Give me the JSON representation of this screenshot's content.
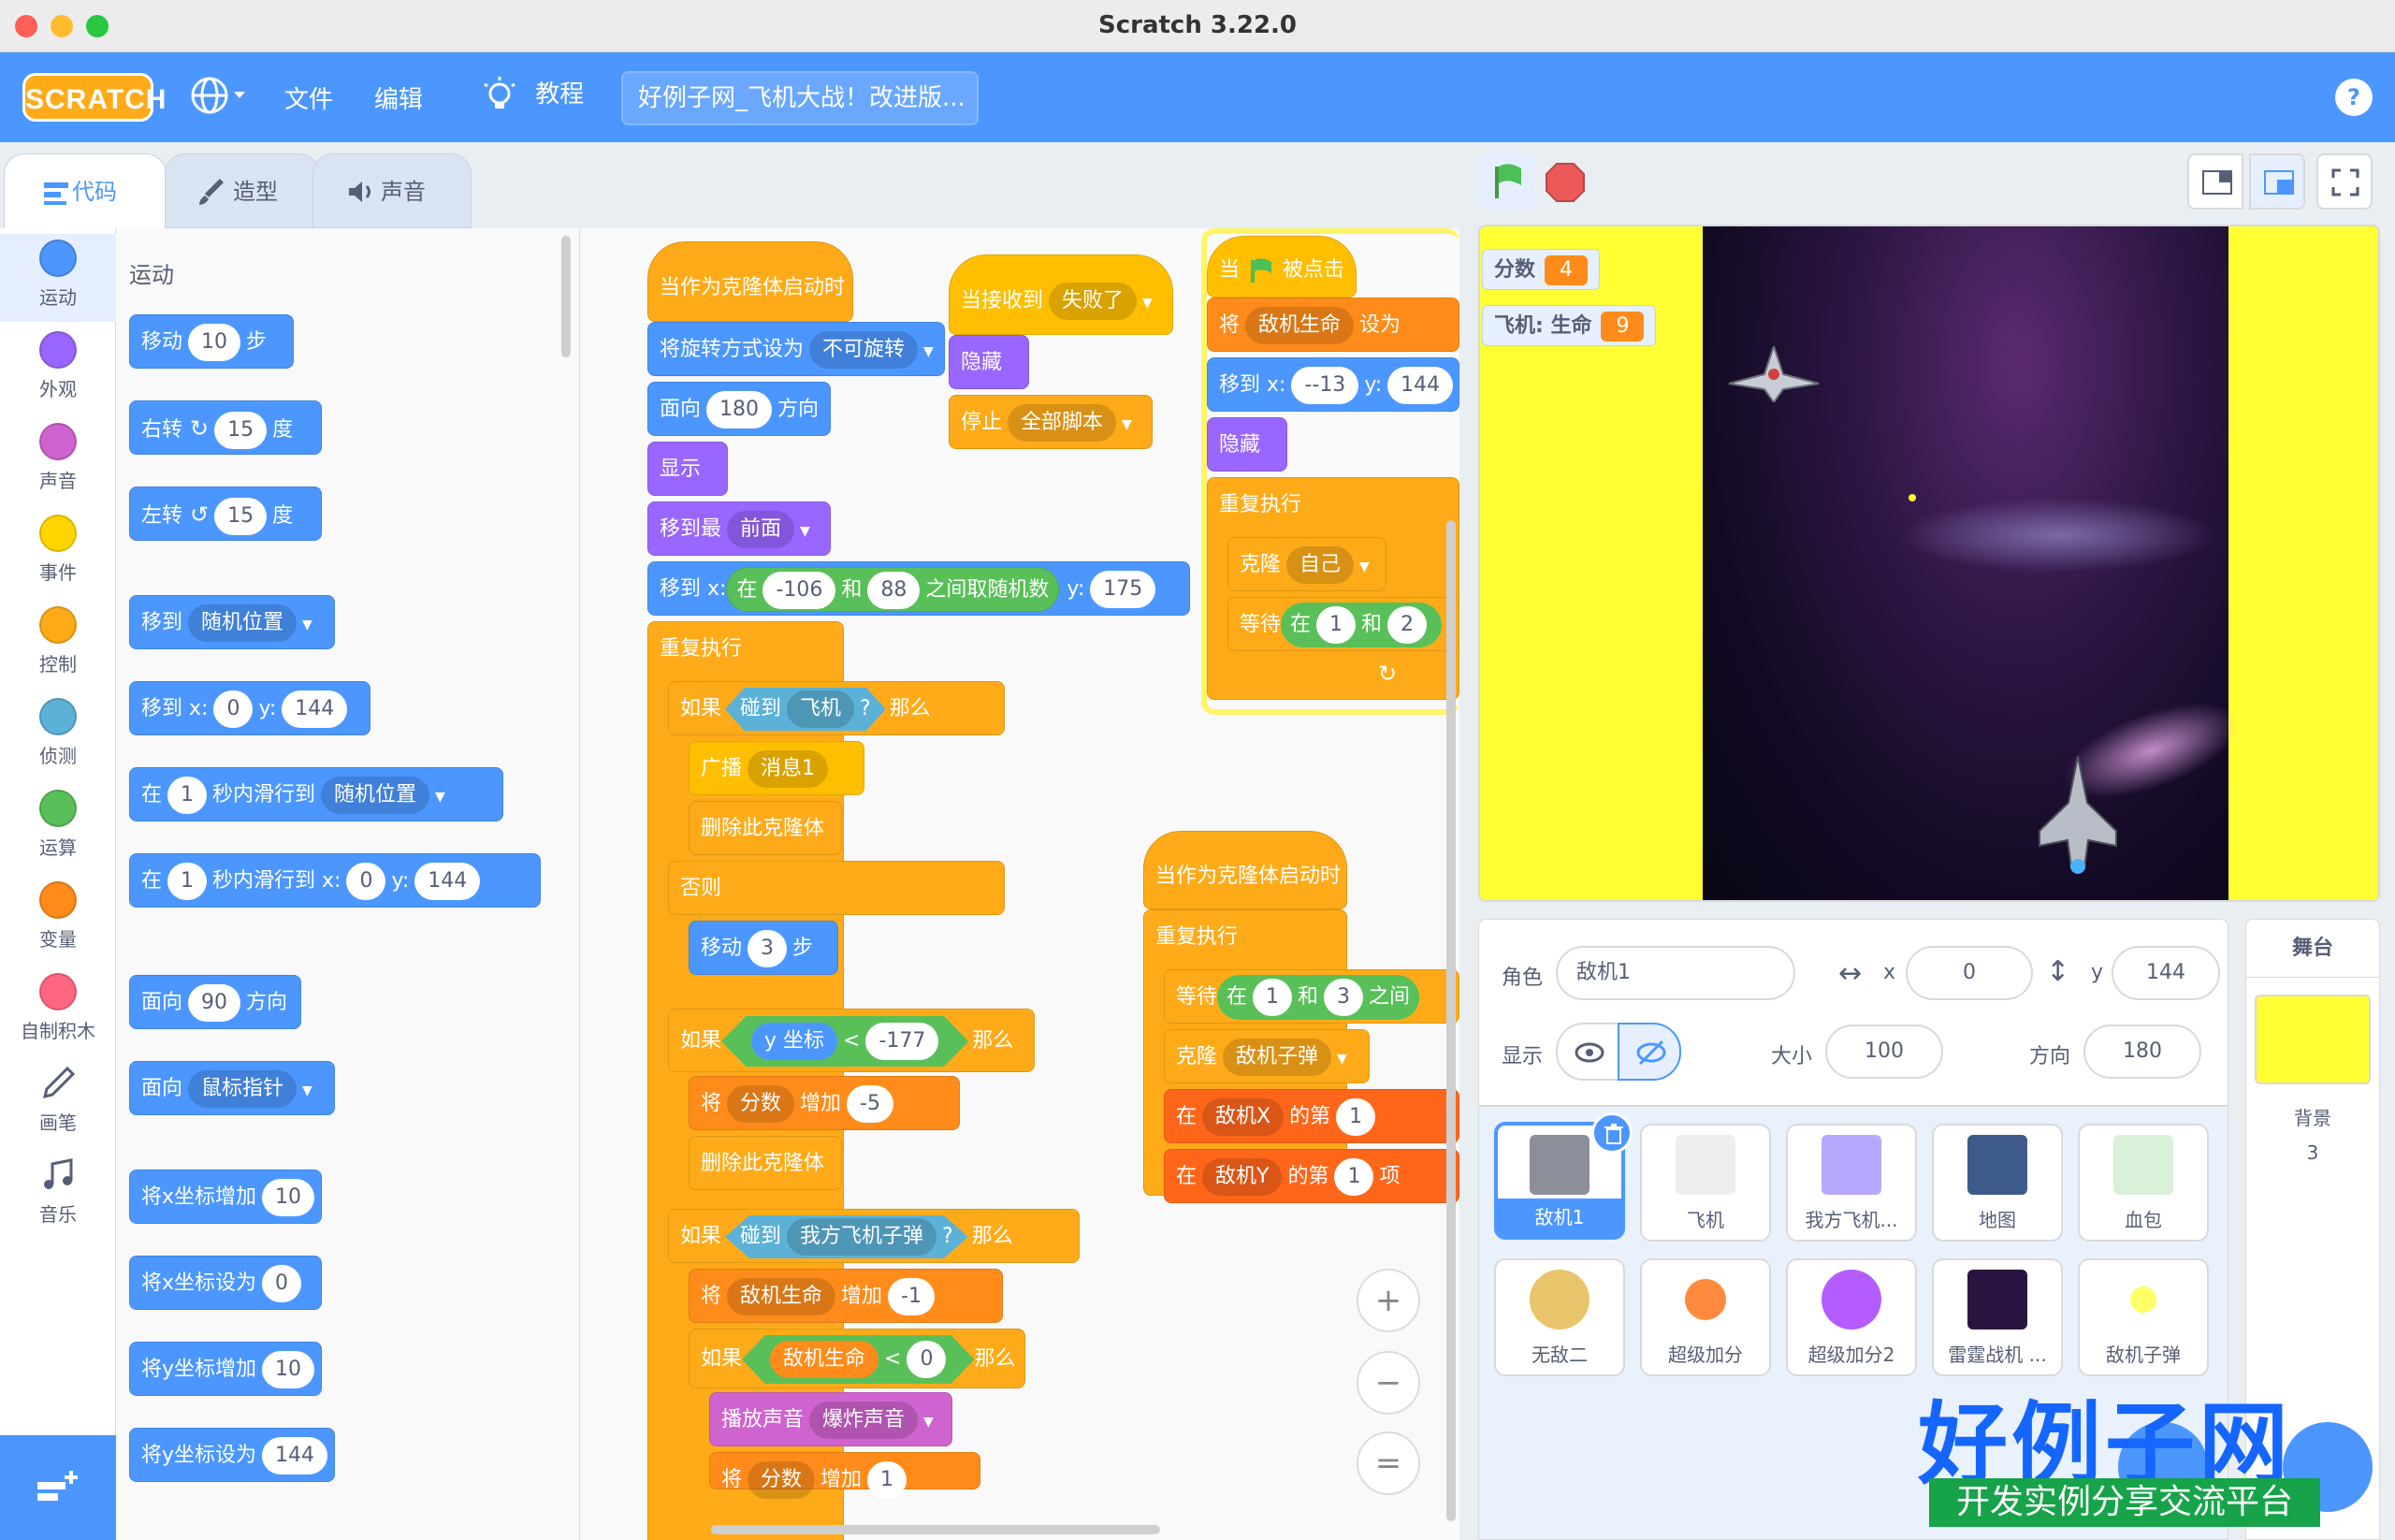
{
  "window": {
    "title": "Scratch 3.22.0"
  },
  "menubar": {
    "logo": "SCRATCH",
    "file": "文件",
    "edit": "编辑",
    "tutorials": "教程",
    "project_title": "好例子网_飞机大战！改进版...",
    "help": "?"
  },
  "tabs": [
    {
      "label": "代码"
    },
    {
      "label": "造型"
    },
    {
      "label": "声音"
    }
  ],
  "categories": [
    {
      "label": "运动",
      "color": "#4c97ff"
    },
    {
      "label": "外观",
      "color": "#9966ff"
    },
    {
      "label": "声音",
      "color": "#cf63cf"
    },
    {
      "label": "事件",
      "color": "#ffd500"
    },
    {
      "label": "控制",
      "color": "#ffab19"
    },
    {
      "label": "侦测",
      "color": "#5cb1d6"
    },
    {
      "label": "运算",
      "color": "#59c059"
    },
    {
      "label": "变量",
      "color": "#ff8c1a"
    },
    {
      "label": "自制积木",
      "color": "#ff6680"
    },
    {
      "label": "画笔",
      "color": "#0fbd8c"
    },
    {
      "label": "音乐",
      "color": "#0fbd8c"
    }
  ],
  "palette": {
    "heading": "运动",
    "move": {
      "a": "移动",
      "v": "10",
      "b": "步"
    },
    "turn_right": {
      "a": "右转",
      "v": "15",
      "b": "度"
    },
    "turn_left": {
      "a": "左转",
      "v": "15",
      "b": "度"
    },
    "goto": {
      "a": "移到",
      "d": "随机位置"
    },
    "goto_xy": {
      "a": "移到 x:",
      "x": "0",
      "b": "y:",
      "y": "144"
    },
    "glide": {
      "a": "在",
      "v": "1",
      "b": "秒内滑行到",
      "d": "随机位置"
    },
    "glide_xy": {
      "a": "在",
      "v": "1",
      "b": "秒内滑行到 x:",
      "x": "0",
      "c": "y:",
      "y": "144"
    },
    "point": {
      "a": "面向",
      "v": "90",
      "b": "方向"
    },
    "point_to": {
      "a": "面向",
      "d": "鼠标指针"
    },
    "change_x": {
      "a": "将x坐标增加",
      "v": "10"
    },
    "set_x": {
      "a": "将x坐标设为",
      "v": "0"
    },
    "change_y": {
      "a": "将y坐标增加",
      "v": "10"
    },
    "set_y": {
      "a": "将y坐标设为",
      "v": "144"
    }
  },
  "scriptA": {
    "hat": "当作为克隆体启动时",
    "rot": {
      "a": "将旋转方式设为",
      "d": "不可旋转"
    },
    "face": {
      "a": "面向",
      "v": "180",
      "b": "方向"
    },
    "show": "显示",
    "front": {
      "a": "移到最",
      "d": "前面"
    },
    "gotor": {
      "a": "移到 x:",
      "b": "在",
      "v1": "-106",
      "c": "和",
      "v2": "88",
      "d": "之间取随机数",
      "e": "y:",
      "y": "175"
    },
    "forever": "重复执行",
    "if1": {
      "a": "如果",
      "b": "碰到",
      "d": "飞机",
      "q": "?",
      "c": "那么"
    },
    "broadcast": {
      "a": "广播",
      "d": "消息1"
    },
    "delete1": "删除此克隆体",
    "else": "否则",
    "move3": {
      "a": "移动",
      "v": "3",
      "b": "步"
    },
    "if2": {
      "a": "如果",
      "r": "y 坐标",
      "op": "<",
      "v": "-177",
      "c": "那么"
    },
    "score": {
      "a": "将",
      "d": "分数",
      "b": "增加",
      "v": "-5"
    },
    "delete2": "删除此克隆体",
    "if3": {
      "a": "如果",
      "b": "碰到",
      "d": "我方飞机子弹",
      "q": "?",
      "c": "那么"
    },
    "hp": {
      "a": "将",
      "d": "敌机生命",
      "b": "增加",
      "v": "-1"
    },
    "if4": {
      "a": "如果",
      "r": "敌机生命",
      "op": "<",
      "v": "0",
      "c": "那么"
    },
    "sound": {
      "a": "播放声音",
      "d": "爆炸声音"
    },
    "last": {
      "a": "将",
      "d": "分数",
      "b": "增加",
      "v": "1"
    }
  },
  "scriptB": {
    "hat": "当接收到",
    "d": "失败了",
    "hide": "隐藏",
    "stop": {
      "a": "停止",
      "d": "全部脚本"
    }
  },
  "scriptC": {
    "hat_a": "当",
    "hat_b": "被点击",
    "set": {
      "a": "将",
      "d": "敌机生命",
      "b": "设为"
    },
    "goto": {
      "a": "移到 x:",
      "x": "--13",
      "b": "y:",
      "y": "144"
    },
    "hide": "隐藏",
    "forever": "重复执行",
    "clone": {
      "a": "克隆",
      "d": "自己"
    },
    "wait": {
      "a": "等待",
      "b": "在",
      "v1": "1",
      "c": "和",
      "v2": "2"
    }
  },
  "scriptD": {
    "hat": "当作为克隆体启动时",
    "forever": "重复执行",
    "wait": {
      "a": "等待",
      "b": "在",
      "v1": "1",
      "c": "和",
      "v2": "3",
      "d": "之间"
    },
    "clone": {
      "a": "克隆",
      "d": "敌机子弹"
    },
    "item1": {
      "a": "在",
      "d": "敌机X",
      "b": "的第",
      "v": "1"
    },
    "item2": {
      "a": "在",
      "d": "敌机Y",
      "b": "的第",
      "v": "1",
      "c": "项"
    }
  },
  "zoom": {
    "in": "+",
    "out": "−",
    "reset": "="
  },
  "stage": {
    "monitor_score": {
      "label": "分数",
      "value": "4"
    },
    "monitor_hp": {
      "label": "飞机: 生命",
      "value": "9"
    }
  },
  "sprite_info": {
    "sprite_label": "角色",
    "sprite_name": "敌机1",
    "x_label": "x",
    "x": "0",
    "y_label": "y",
    "y": "144",
    "show_label": "显示",
    "size_label": "大小",
    "size": "100",
    "dir_label": "方向",
    "direction": "180"
  },
  "sprites": [
    {
      "name": "敌机1",
      "color": "#8a8f99"
    },
    {
      "name": "飞机",
      "color": "#eeeeee"
    },
    {
      "name": "我方飞机...",
      "color": "#b9a8ff"
    },
    {
      "name": "地图",
      "color": "#3d5a8a"
    },
    {
      "name": "血包",
      "color": "#d9f0d9"
    },
    {
      "name": "无敌二",
      "color": "#e8c46a"
    },
    {
      "name": "超级加分",
      "color": "#ff8a3d"
    },
    {
      "name": "超级加分2",
      "color": "#b45cff"
    },
    {
      "name": "雷霆战机 ...",
      "color": "#2a1540"
    },
    {
      "name": "敌机子弹",
      "color": "#ffff66"
    }
  ],
  "stage_panel": {
    "title": "舞台",
    "backdrop_label": "背景",
    "backdrop_count": "3"
  },
  "watermark": {
    "line1": "好例子网",
    "line2": "开发实例分享交流平台"
  }
}
